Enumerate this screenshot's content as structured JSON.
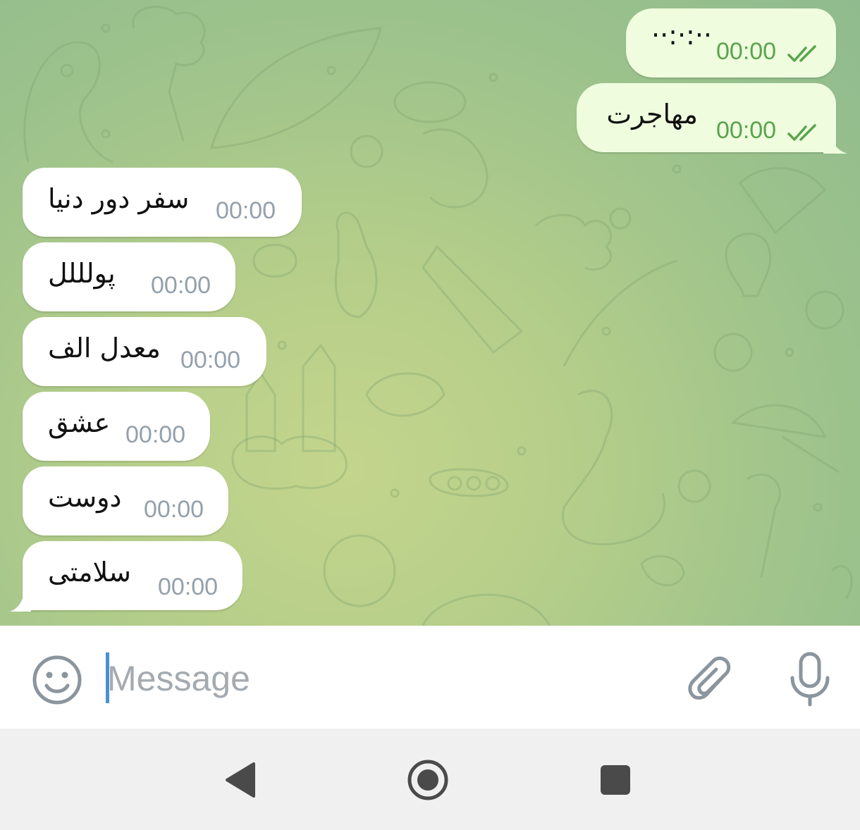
{
  "chat": {
    "outgoing": [
      {
        "text": "··:·:··",
        "time": "00:00",
        "status_icon": "double-check-icon"
      },
      {
        "text": "مهاجرت",
        "time": "00:00",
        "status_icon": "double-check-icon"
      }
    ],
    "incoming": [
      {
        "text": "سفر دور دنیا",
        "time": "00:00"
      },
      {
        "text": "پولللل",
        "time": "00:00"
      },
      {
        "text": "معدل الف",
        "time": "00:00"
      },
      {
        "text": "عشق",
        "time": "00:00"
      },
      {
        "text": "دوست",
        "time": "00:00"
      },
      {
        "text": "سلامتی",
        "time": "00:00"
      }
    ]
  },
  "composer": {
    "placeholder": "Message",
    "emoji_icon": "emoji-icon",
    "attach_icon": "paperclip-icon",
    "mic_icon": "microphone-icon"
  },
  "navigation": {
    "back_icon": "back-triangle-icon",
    "home_icon": "home-circle-icon",
    "recents_icon": "recents-square-icon"
  },
  "colors": {
    "outgoing_bubble": "#effdde",
    "incoming_bubble": "#ffffff",
    "outgoing_time": "#5aa34e",
    "incoming_time": "#94a0ab",
    "caret": "#4b8fd4"
  }
}
